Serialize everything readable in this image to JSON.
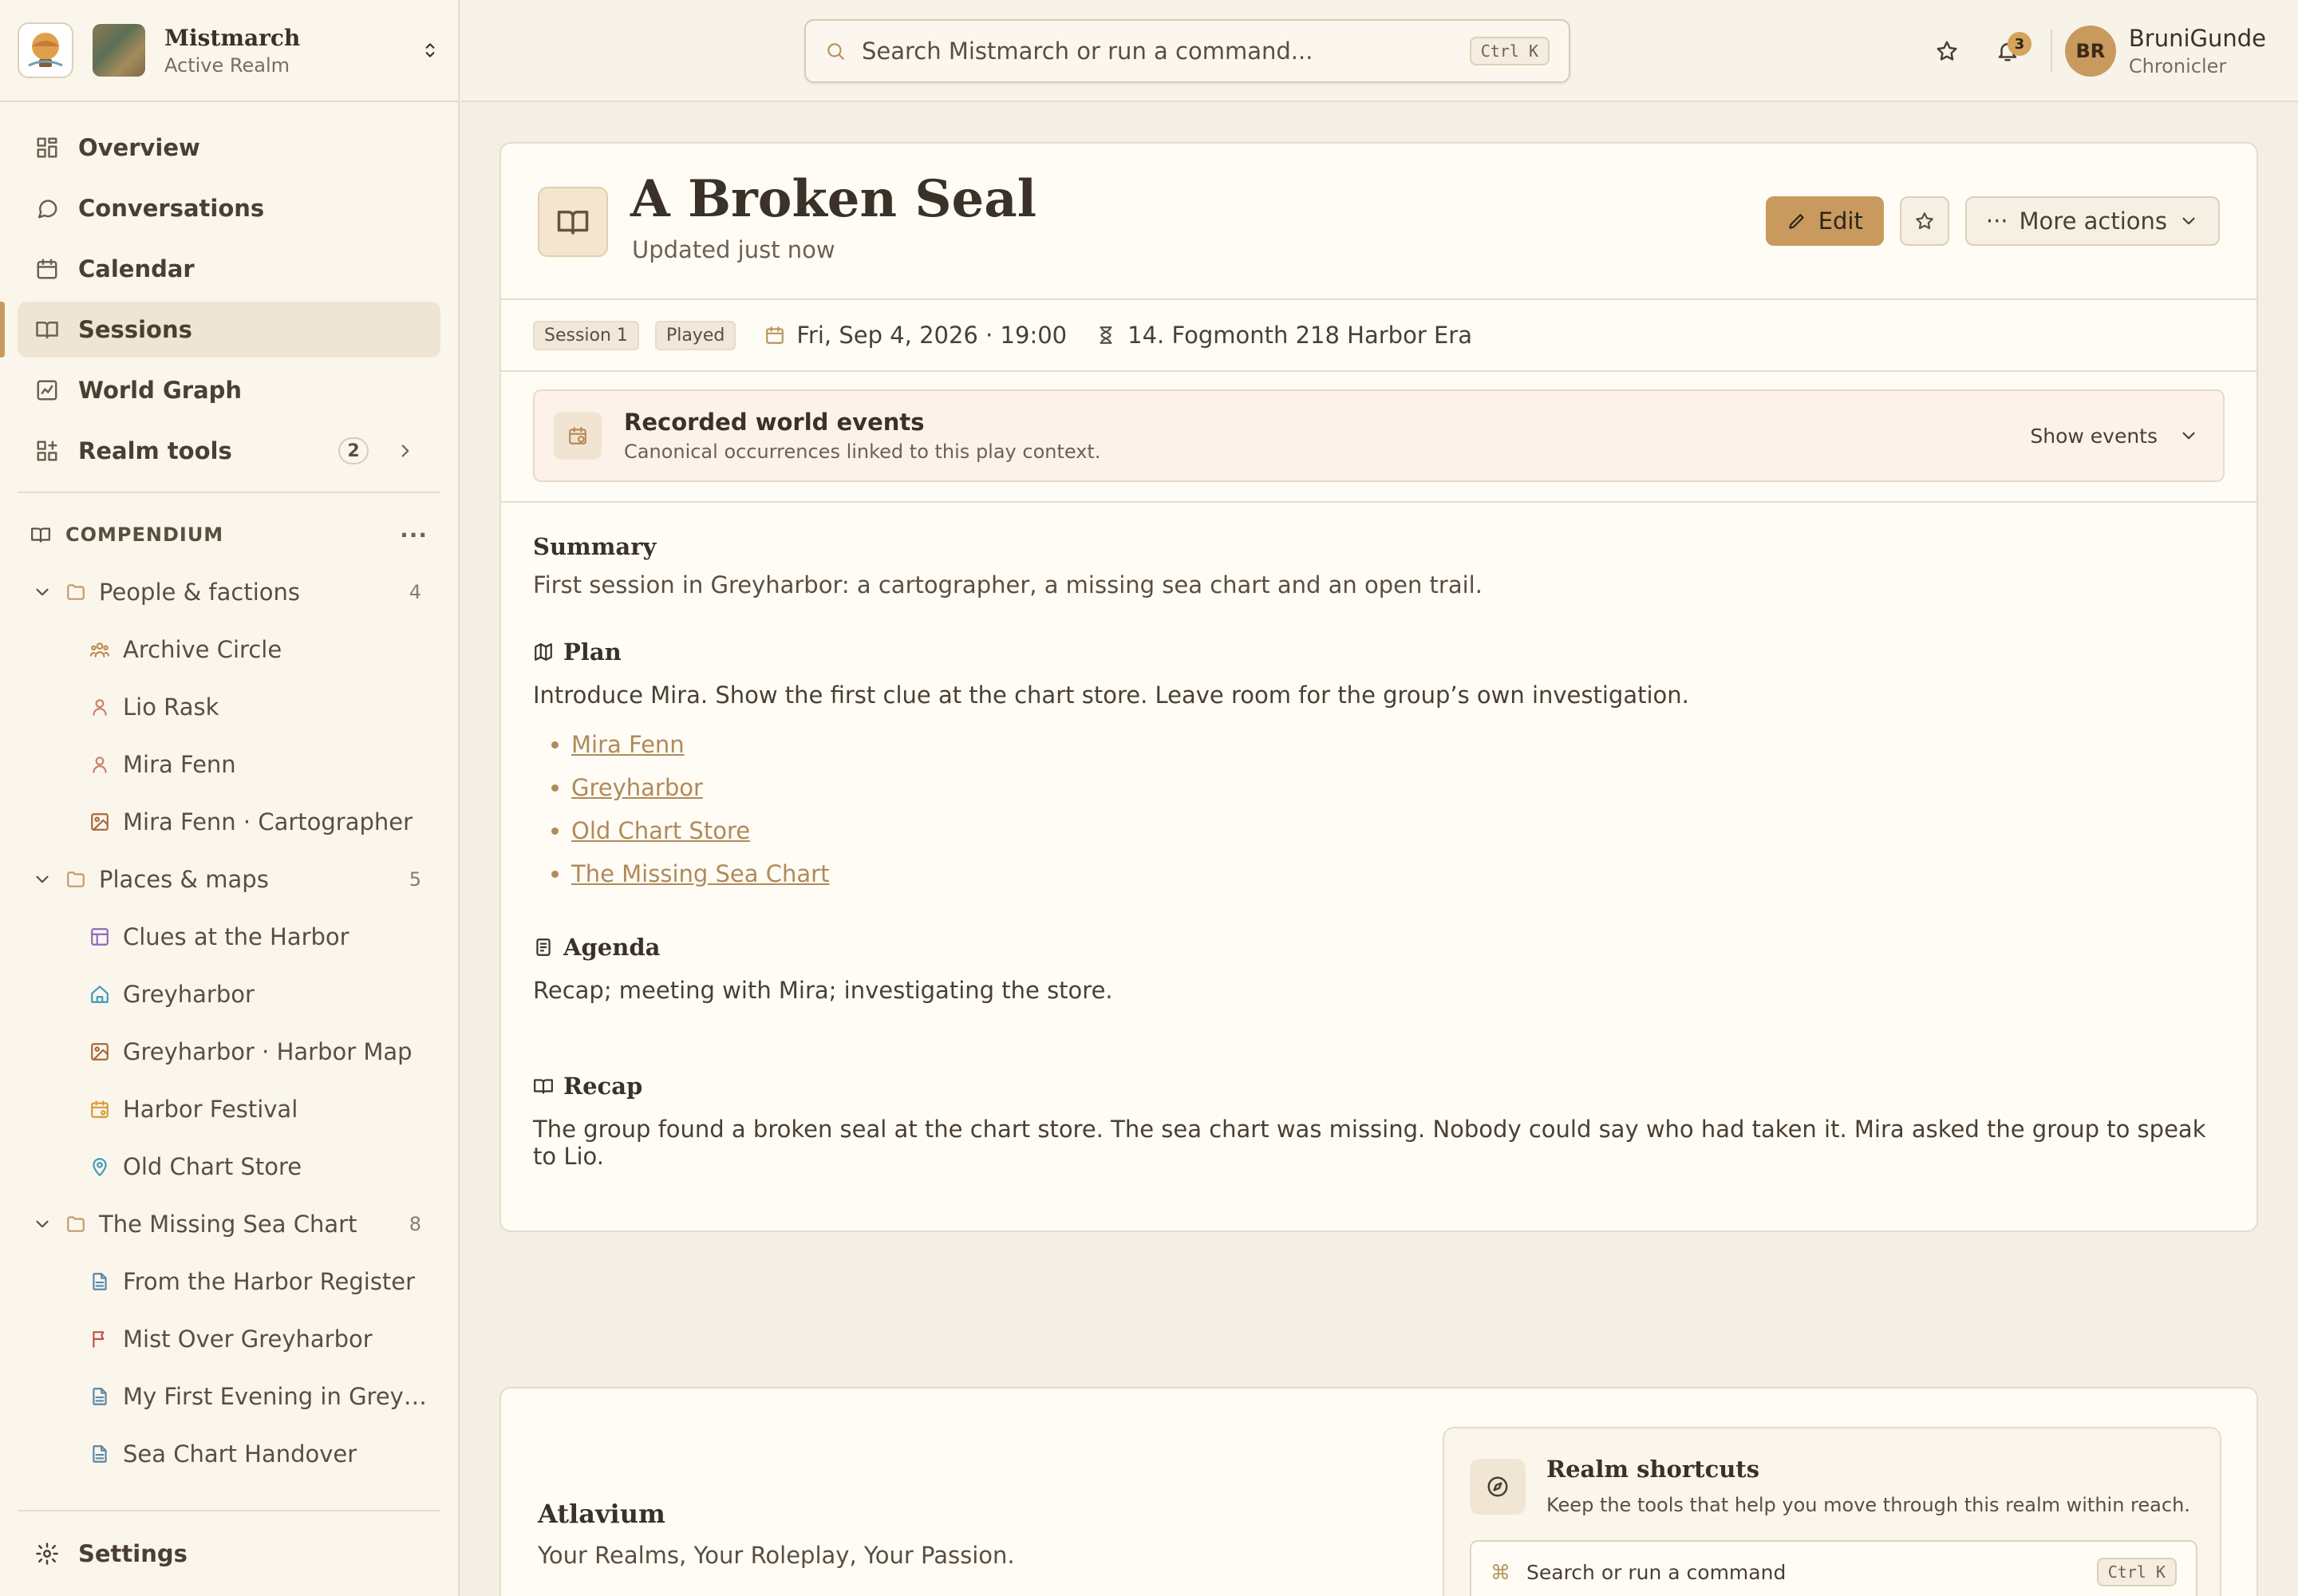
{
  "brand": {
    "realm_name": "Mistmarch",
    "realm_status": "Active Realm"
  },
  "nav": {
    "items": [
      {
        "label": "Overview",
        "icon": "dashboard-icon"
      },
      {
        "label": "Conversations",
        "icon": "chat-icon"
      },
      {
        "label": "Calendar",
        "icon": "calendar-icon"
      },
      {
        "label": "Sessions",
        "icon": "book-icon",
        "active": true
      },
      {
        "label": "World Graph",
        "icon": "graph-icon"
      },
      {
        "label": "Realm tools",
        "icon": "tools-icon",
        "badge": "2"
      }
    ]
  },
  "compendium": {
    "title": "COMPENDIUM",
    "folders": [
      {
        "label": "People & factions",
        "count": "4",
        "items": [
          "Archive Circle",
          "Lio Rask",
          "Mira Fenn",
          "Mira Fenn · Cartographer"
        ]
      },
      {
        "label": "Places & maps",
        "count": "5",
        "items": [
          "Clues at the Harbor",
          "Greyharbor",
          "Greyharbor · Harbor Map",
          "Harbor Festival",
          "Old Chart Store"
        ]
      },
      {
        "label": "The Missing Sea Chart",
        "count": "8",
        "items": [
          "From the Harbor Register",
          "Mist Over Greyharbor",
          "My First Evening in Grey…",
          "Sea Chart Handover"
        ]
      }
    ]
  },
  "settings_label": "Settings",
  "search": {
    "placeholder": "Search Mistmarch or run a command...",
    "shortcut": "Ctrl K"
  },
  "header": {
    "notification_count": "3",
    "avatar_initials": "BR",
    "user_name": "BruniGunde",
    "user_role": "Chronicler"
  },
  "session": {
    "title": "A Broken Seal",
    "updated": "Updated just now",
    "edit_label": "Edit",
    "more_label": "More actions",
    "chip_session": "Session 1",
    "chip_status": "Played",
    "date": "Fri, Sep 4, 2026 · 19:00",
    "world_date": "14. Fogmonth 218 Harbor Era"
  },
  "events": {
    "title": "Recorded world events",
    "subtitle": "Canonical occurrences linked to this play context.",
    "toggle": "Show events"
  },
  "content": {
    "summary_h": "Summary",
    "summary": "First session in Greyharbor: a cartographer, a missing sea chart and an open trail.",
    "plan_h": "Plan",
    "plan": "Introduce Mira. Show the first clue at the chart store. Leave room for the group’s own investigation.",
    "links": [
      "Mira Fenn",
      "Greyharbor",
      "Old Chart Store",
      "The Missing Sea Chart"
    ],
    "agenda_h": "Agenda",
    "agenda": "Recap; meeting with Mira; investigating the store.",
    "recap_h": "Recap",
    "recap": "The group found a broken seal at the chart store. The sea chart was missing. Nobody could say who had taken it. Mira asked the group to speak to Lio."
  },
  "footer": {
    "brand": "Atlavium",
    "tagline": "Your Realms, Your Roleplay, Your Passion.",
    "shortcuts_title": "Realm shortcuts",
    "shortcuts_sub": "Keep the tools that help you move through this realm within reach.",
    "shortcuts_search": "Search or run a command",
    "shortcuts_key": "Ctrl K"
  },
  "colors": {
    "accent": "#c89a5e",
    "link": "#b08a5a",
    "background": "#f4efe4"
  }
}
